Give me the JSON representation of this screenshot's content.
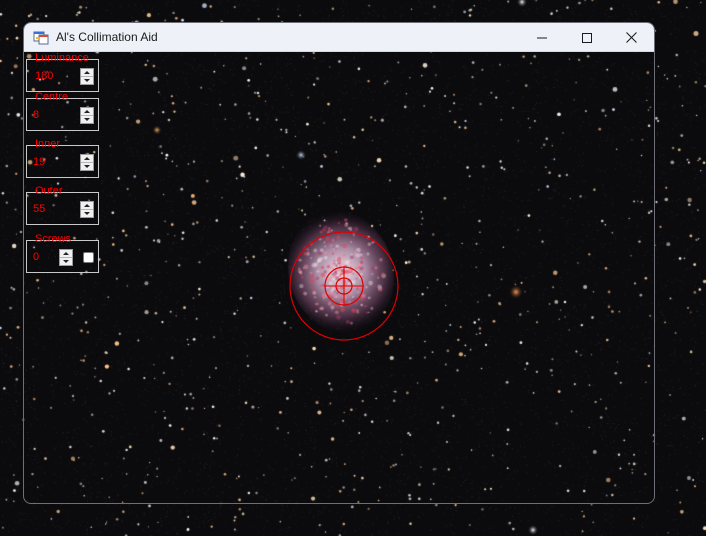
{
  "window": {
    "title": "Al's Collimation Aid",
    "icon": "app-window-icon",
    "buttons": [
      "minimize-icon",
      "maximize-icon",
      "close-icon"
    ]
  },
  "controls": {
    "luminance": {
      "label": "Luminance",
      "value": "180"
    },
    "centre": {
      "label": "Centre",
      "value": "8"
    },
    "inner": {
      "label": "Inner",
      "value": "19"
    },
    "outer": {
      "label": "Outer",
      "value": "55"
    },
    "screws": {
      "label": "Screws",
      "value": "0",
      "checked": false
    }
  },
  "colors": {
    "accent_red": "#ff0000",
    "background": "#0a0a0c"
  }
}
